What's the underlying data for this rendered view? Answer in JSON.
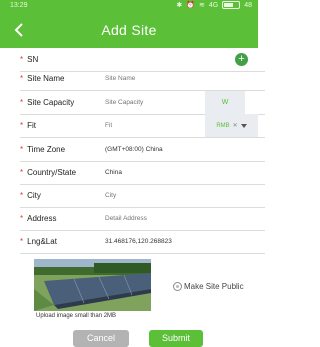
{
  "status_bar": {
    "time": "13:29",
    "signal_text": "4G",
    "battery_text": "48"
  },
  "header": {
    "title": "Add Site"
  },
  "form": {
    "sn": {
      "label": "SN"
    },
    "site_name": {
      "label": "Site Name",
      "placeholder": "Site Name"
    },
    "site_capacity": {
      "label": "Site Capacity",
      "placeholder": "Site Capacity",
      "unit": "W"
    },
    "fit": {
      "label": "Fit",
      "placeholder": "Fit",
      "currency": "RMB",
      "clear": "✕"
    },
    "time_zone": {
      "label": "Time Zone",
      "value": "(GMT+08:00) China"
    },
    "country_state": {
      "label": "Country/State",
      "value": "China"
    },
    "city": {
      "label": "City",
      "placeholder": "City"
    },
    "address": {
      "label": "Address",
      "placeholder": "Detail Address"
    },
    "lng_lat": {
      "label": "Lng&Lat",
      "value": "31.468176,120.268823"
    }
  },
  "required_mark": "*",
  "upload": {
    "caption": "Upload image small than 2MB"
  },
  "make_public": {
    "label": "Make Site Public",
    "checked": false
  },
  "buttons": {
    "cancel": "Cancel",
    "submit": "Submit"
  },
  "colors": {
    "accent": "#5bbf38",
    "required": "#e53935",
    "add_button": "#43a047",
    "cancel": "#b3b3b3"
  },
  "icons": {
    "back": "chevron-left-icon",
    "add": "plus-circle-icon",
    "dropdown": "chevron-down-icon"
  }
}
